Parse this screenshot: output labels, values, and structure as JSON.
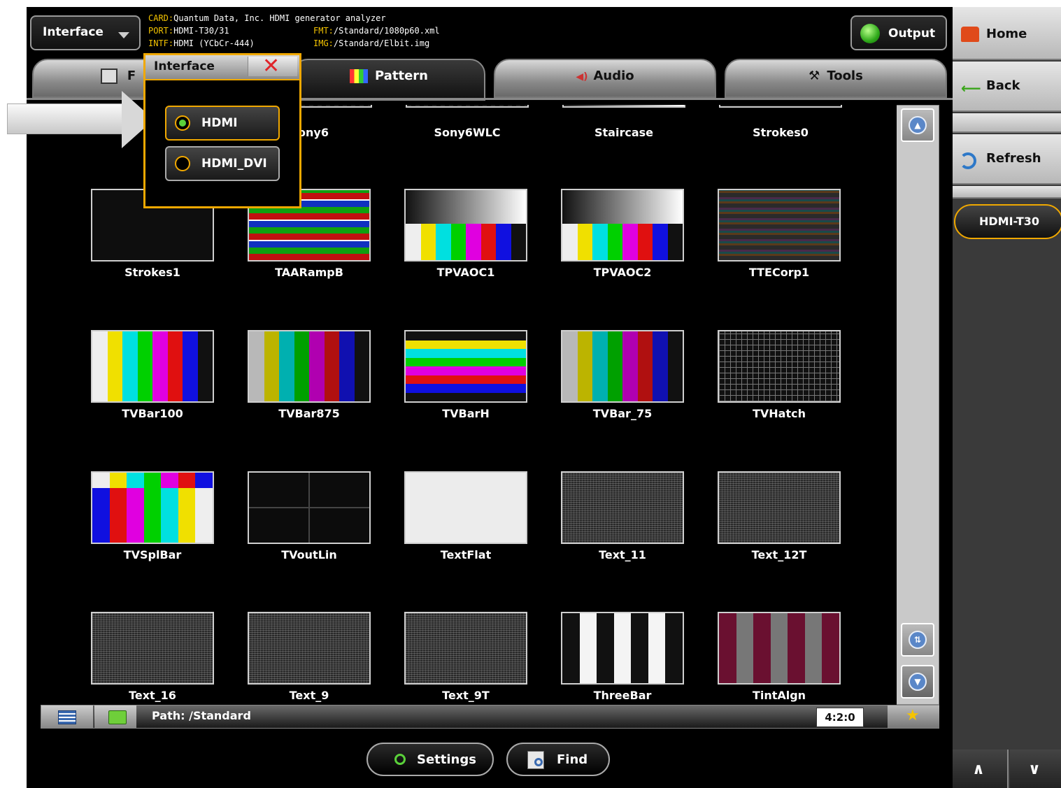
{
  "header": {
    "interface_label": "Interface",
    "info": [
      {
        "key": "CARD:",
        "value": "Quantum Data, Inc. HDMI generator analyzer"
      },
      {
        "key": "PORT:",
        "value": "HDMI-T30/31"
      },
      {
        "key": "FMT:",
        "value": "/Standard/1080p60.xml"
      },
      {
        "key": "INTF:",
        "value": "HDMI (YCbCr-444)"
      },
      {
        "key": "IMG:",
        "value": "/Standard/Elbit.img"
      }
    ],
    "output_label": "Output"
  },
  "tabs": [
    {
      "label": "F",
      "icon": "format-icon"
    },
    {
      "label": "Pattern",
      "icon": "pattern-icon"
    },
    {
      "label": "Audio",
      "icon": "speaker-icon"
    },
    {
      "label": "Tools",
      "icon": "tools-icon"
    }
  ],
  "popup": {
    "title": "Interface",
    "options": [
      {
        "label": "HDMI",
        "selected": true
      },
      {
        "label": "HDMI_DVI",
        "selected": false
      }
    ]
  },
  "patterns": [
    {
      "name": "Strokes1",
      "style": "dark"
    },
    {
      "name": "TAARampB",
      "style": "ramp"
    },
    {
      "name": "TPVAOC1",
      "style": "tpva"
    },
    {
      "name": "TPVAOC2",
      "style": "tpva"
    },
    {
      "name": "TTECorp1",
      "style": "ttecorp"
    },
    {
      "name": "TVBar100",
      "style": "bars100"
    },
    {
      "name": "TVBar875",
      "style": "bars75"
    },
    {
      "name": "TVBarH",
      "style": "barsh"
    },
    {
      "name": "TVBar_75",
      "style": "bars75"
    },
    {
      "name": "TVHatch",
      "style": "hatch"
    },
    {
      "name": "TVSplBar",
      "style": "splbar"
    },
    {
      "name": "TVoutLin",
      "style": "outlin"
    },
    {
      "name": "TextFlat",
      "style": "flat"
    },
    {
      "name": "Text_11",
      "style": "noise"
    },
    {
      "name": "Text_12T",
      "style": "noise"
    },
    {
      "name": "Text_16",
      "style": "noise"
    },
    {
      "name": "Text_9",
      "style": "noise"
    },
    {
      "name": "Text_9T",
      "style": "noise"
    },
    {
      "name": "ThreeBar",
      "style": "threebar"
    },
    {
      "name": "TintAlgn",
      "style": "tint"
    }
  ],
  "top_row_labels": [
    "ony6",
    "Sony6WLC",
    "Staircase",
    "Strokes0"
  ],
  "statusbar": {
    "path": "Path: /Standard",
    "sampling": "4:2:0"
  },
  "bottom": {
    "settings_label": "Settings",
    "find_label": "Find"
  },
  "sidebar": {
    "home_label": "Home",
    "back_label": "Back",
    "refresh_label": "Refresh",
    "port_label": "HDMI-T30"
  }
}
